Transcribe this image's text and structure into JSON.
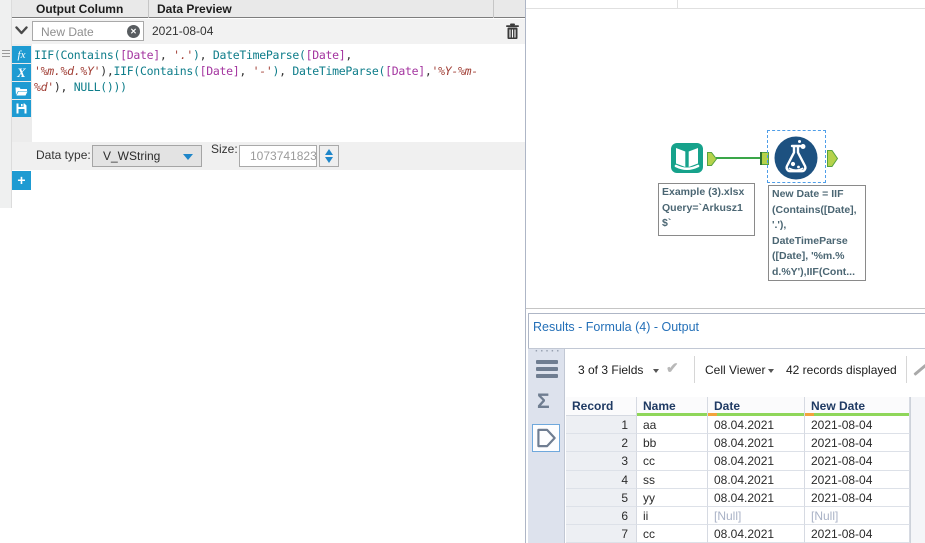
{
  "colors": {
    "accent_blue": "#1e9bd2",
    "input_tool_teal": "#16a28b",
    "formula_tool_navy": "#1d5180",
    "connection_green": "#3aa648",
    "anchor_green": "#b5d24b",
    "results_title_blue": "#2470b8",
    "quality_green": "#8fd65a",
    "quality_orange": "#f2a33c"
  },
  "formula_panel": {
    "header": {
      "output_column": "Output Column",
      "data_preview": "Data Preview"
    },
    "expression": {
      "output_name": "New Date",
      "preview_value": "2021-08-04",
      "clear_glyph": "✕"
    },
    "tokens": [
      {
        "t": "fn",
        "v": "IIF"
      },
      {
        "t": "fn",
        "v": "("
      },
      {
        "t": "fn",
        "v": "Contains"
      },
      {
        "t": "fn",
        "v": "("
      },
      {
        "t": "fld",
        "v": "[Date]"
      },
      {
        "t": "pl",
        "v": ", "
      },
      {
        "t": "str",
        "v": "'.'"
      },
      {
        "t": "fn",
        "v": ")"
      },
      {
        "t": "pl",
        "v": ", "
      },
      {
        "t": "fn",
        "v": "DateTimeParse"
      },
      {
        "t": "fn",
        "v": "("
      },
      {
        "t": "fld",
        "v": "[Date]"
      },
      {
        "t": "pl",
        "v": ","
      },
      {
        "t": "br"
      },
      {
        "t": "str",
        "v": "'%m.%d.%Y'"
      },
      {
        "t": "pl",
        "v": "),"
      },
      {
        "t": "fn",
        "v": "IIF"
      },
      {
        "t": "fn",
        "v": "("
      },
      {
        "t": "fn",
        "v": "Contains"
      },
      {
        "t": "fn",
        "v": "("
      },
      {
        "t": "fld",
        "v": "[Date]"
      },
      {
        "t": "pl",
        "v": ", "
      },
      {
        "t": "str",
        "v": "'-'"
      },
      {
        "t": "fn",
        "v": ")"
      },
      {
        "t": "pl",
        "v": ", "
      },
      {
        "t": "fn",
        "v": "DateTimeParse"
      },
      {
        "t": "fn",
        "v": "("
      },
      {
        "t": "fld",
        "v": "[Date]"
      },
      {
        "t": "pl",
        "v": ","
      },
      {
        "t": "str",
        "v": "'%Y-%m-"
      },
      {
        "t": "br"
      },
      {
        "t": "str",
        "v": "%d'"
      },
      {
        "t": "pl",
        "v": "), "
      },
      {
        "t": "fn",
        "v": "NULL"
      },
      {
        "t": "fn",
        "v": "()))"
      }
    ],
    "data_type_label": "Data type:",
    "data_type_value": "V_WString",
    "size_label": "Size:",
    "size_value": "1073741823",
    "add_button_label": "+"
  },
  "canvas": {
    "input_tool_annotation": [
      "Example (3).xlsx",
      "Query=`Arkusz1",
      "$`"
    ],
    "formula_tool_annotation": [
      "New Date = IIF",
      "(Contains([Date],",
      "'.'),",
      "DateTimeParse",
      "([Date], '%m.%",
      "d.%Y'),IIF(Cont..."
    ]
  },
  "results": {
    "title": "Results - Formula (4) - Output",
    "toolbar": {
      "fields_label": "3 of 3 Fields",
      "check_glyph": "✔",
      "cell_viewer_label": "Cell Viewer",
      "records_label": "42 records displayed"
    },
    "strip": {
      "sigma_glyph": "Σ",
      "dots": "·····"
    },
    "table": {
      "headers": [
        "Record",
        "Name",
        "Date",
        "New Date"
      ],
      "quality": [
        "none",
        "green",
        "orange-green",
        "orange-green"
      ],
      "null_token": "[Null]",
      "rows": [
        [
          "1",
          "aa",
          "08.04.2021",
          "2021-08-04"
        ],
        [
          "2",
          "bb",
          "08.04.2021",
          "2021-08-04"
        ],
        [
          "3",
          "cc",
          "08.04.2021",
          "2021-08-04"
        ],
        [
          "4",
          "ss",
          "08.04.2021",
          "2021-08-04"
        ],
        [
          "5",
          "yy",
          "08.04.2021",
          "2021-08-04"
        ],
        [
          "6",
          "ii",
          "[Null]",
          "[Null]"
        ],
        [
          "7",
          "cc",
          "08.04.2021",
          "2021-08-04"
        ]
      ]
    }
  }
}
